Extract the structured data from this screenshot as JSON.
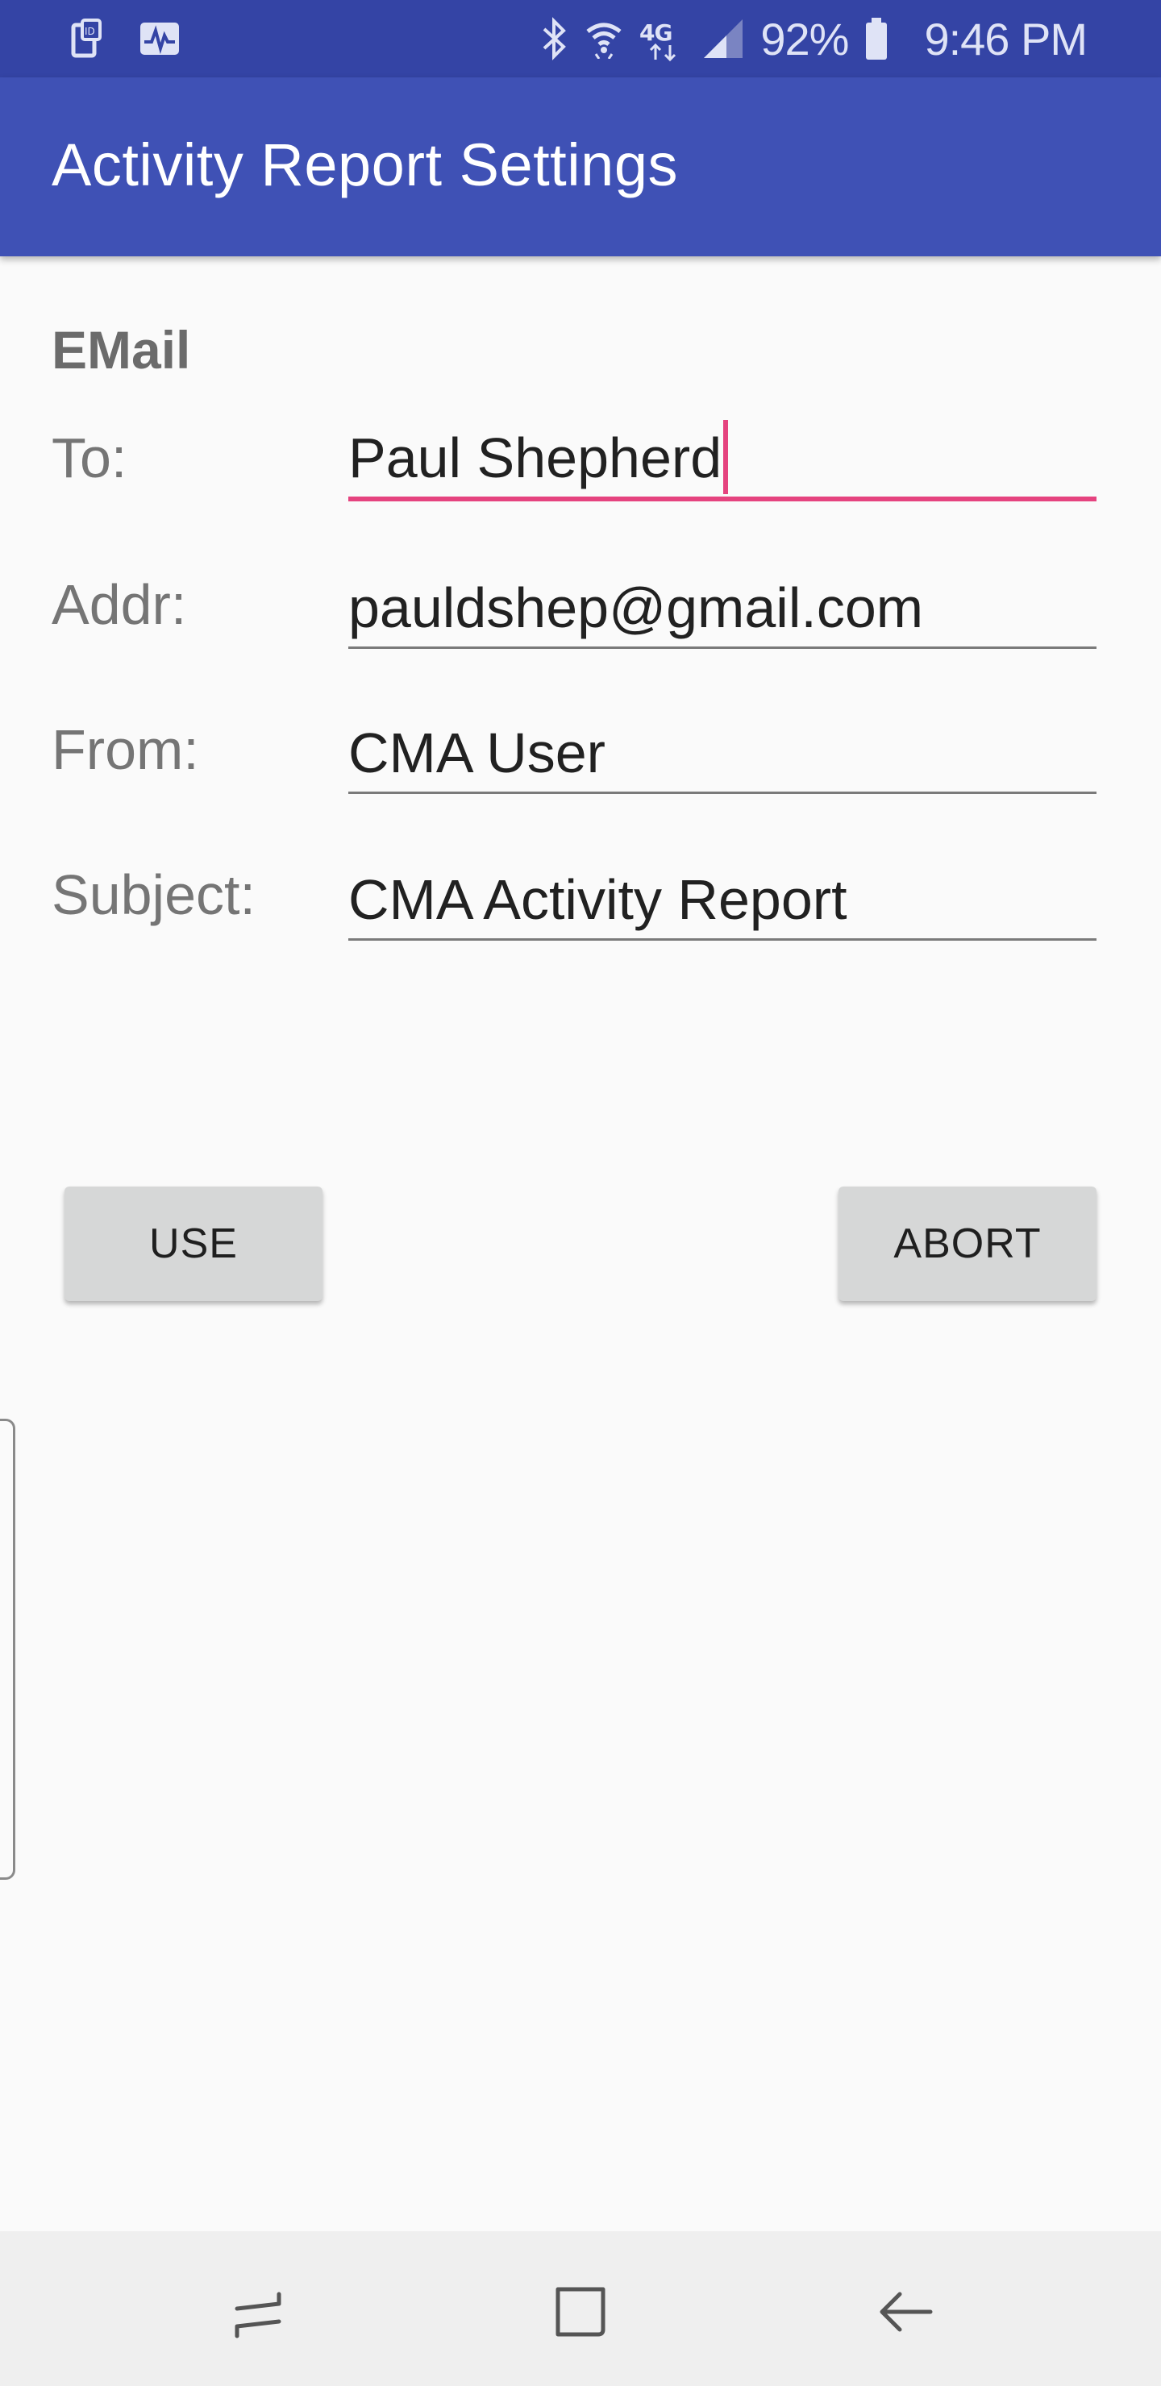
{
  "status_bar": {
    "battery_percent": "92%",
    "time": "9:46 PM",
    "network_label": "4G",
    "icons": [
      "id-card-icon",
      "activity-monitor-icon",
      "bluetooth-icon",
      "wifi-icon",
      "lte-icon",
      "signal-icon",
      "battery-icon"
    ]
  },
  "app_bar": {
    "title": "Activity Report Settings",
    "color": "#3f51b5"
  },
  "form": {
    "section_title": "EMail",
    "to_label": "To:",
    "to_value": "Paul Shepherd",
    "addr_label": "Addr:",
    "addr_value": "pauldshep@gmail.com",
    "from_label": "From:",
    "from_value": "CMA User",
    "subject_label": "Subject:",
    "subject_value": "CMA Activity Report",
    "focus_color": "#e5437f"
  },
  "buttons": {
    "use_label": "USE",
    "abort_label": "ABORT"
  },
  "nav_bar": {
    "icons": [
      "recents-icon",
      "home-icon",
      "back-icon"
    ]
  }
}
